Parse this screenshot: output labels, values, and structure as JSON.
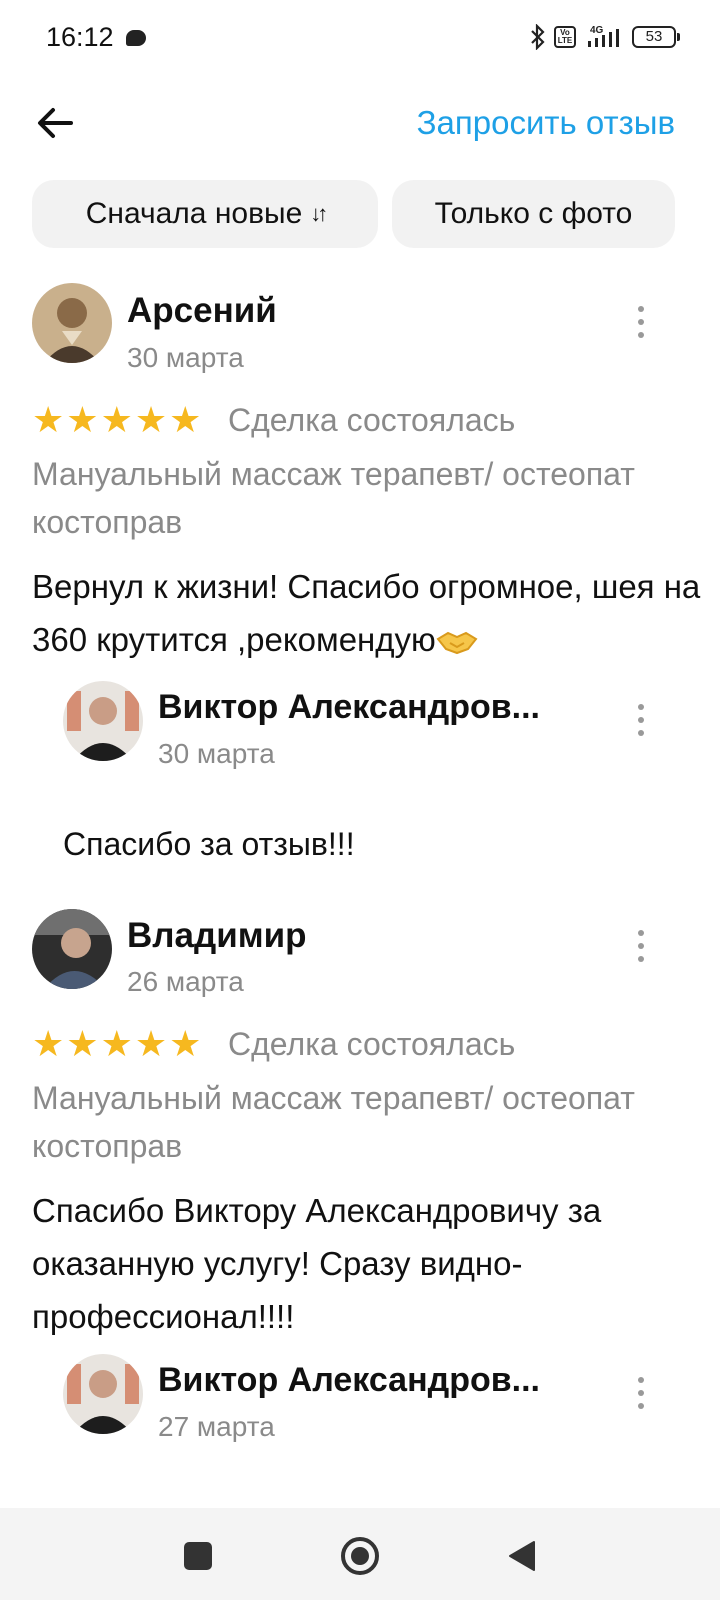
{
  "status": {
    "time": "16:12",
    "battery": "53",
    "volte": "Vo LTE",
    "network": "4G"
  },
  "header": {
    "request_label": "Запросить отзыв"
  },
  "filters": {
    "sort_label": "Сначала новые",
    "sort_glyph": "↓↑",
    "photo_label": "Только с фото"
  },
  "reviews": [
    {
      "author": "Арсений",
      "date": "30 марта",
      "rating": 5,
      "deal": "Сделка состоялась",
      "service": "Мануальный массаж терапевт/ остеопат костоправ",
      "text": "Вернул к жизни! Спасибо огромное, шея на 360 крутится ,рекомендую",
      "reply": {
        "author": "Виктор Александров...",
        "date": "30 марта",
        "text": "Спасибо за отзыв!!!"
      }
    },
    {
      "author": "Владимир",
      "date": "26 марта",
      "rating": 5,
      "deal": "Сделка состоялась",
      "service": "Мануальный массаж терапевт/ остеопат костоправ",
      "text": "Спасибо Виктору Александровичу за оказанную услугу! Сразу видно- профессионал!!!!",
      "reply": {
        "author": "Виктор Александров...",
        "date": "27 марта"
      }
    }
  ],
  "colors": {
    "accent": "#1ea0e6",
    "star": "#f6b81f",
    "muted": "#8a8a8a",
    "chip_bg": "#f2f2f2"
  },
  "icons": [
    "back-arrow-icon",
    "sort-icon",
    "more-vertical-icon",
    "star-icon",
    "handshake-emoji",
    "bluetooth-icon",
    "signal-icon",
    "battery-icon",
    "nav-square-icon",
    "nav-circle-icon",
    "nav-back-triangle-icon"
  ]
}
